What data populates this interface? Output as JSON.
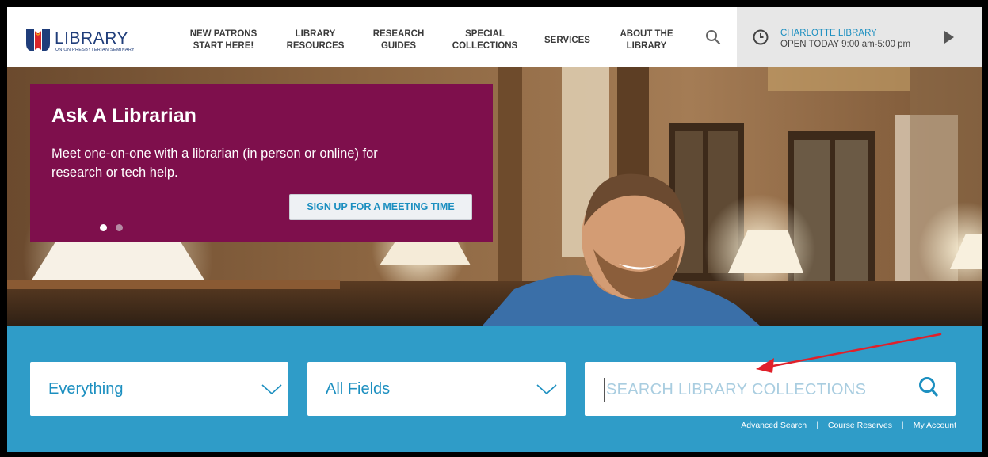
{
  "header": {
    "logo_word": "LIBRARY",
    "logo_sub": "UNION PRESBYTERIAN SEMINARY",
    "nav": [
      {
        "line1": "NEW PATRONS",
        "line2": "START HERE!"
      },
      {
        "line1": "LIBRARY",
        "line2": "RESOURCES"
      },
      {
        "line1": "RESEARCH",
        "line2": "GUIDES"
      },
      {
        "line1": "SPECIAL",
        "line2": "COLLECTIONS"
      },
      {
        "line1": "SERVICES",
        "line2": ""
      },
      {
        "line1": "ABOUT THE",
        "line2": "LIBRARY"
      }
    ],
    "search_icon": "search-icon"
  },
  "hours": {
    "location": "CHARLOTTE LIBRARY",
    "status": "OPEN TODAY 9:00 am-5:00 pm",
    "clock_icon": "clock-icon",
    "next_icon": "play-icon"
  },
  "hero": {
    "title": "Ask A Librarian",
    "text": "Meet one-on-one with a librarian (in person or online) for research or tech help.",
    "button": "SIGN UP FOR A MEETING TIME",
    "slide_count": 2,
    "active_slide": 1
  },
  "search": {
    "scope": "Everything",
    "field": "All Fields",
    "placeholder": "SEARCH LIBRARY COLLECTIONS",
    "links": [
      "Advanced Search",
      "Course Reserves",
      "My Account"
    ]
  },
  "colors": {
    "brand_blue": "#1c8fc0",
    "band_blue": "#2f9cc8",
    "promo_magenta": "#7e0f4c",
    "annotation_red": "#e0202a"
  }
}
